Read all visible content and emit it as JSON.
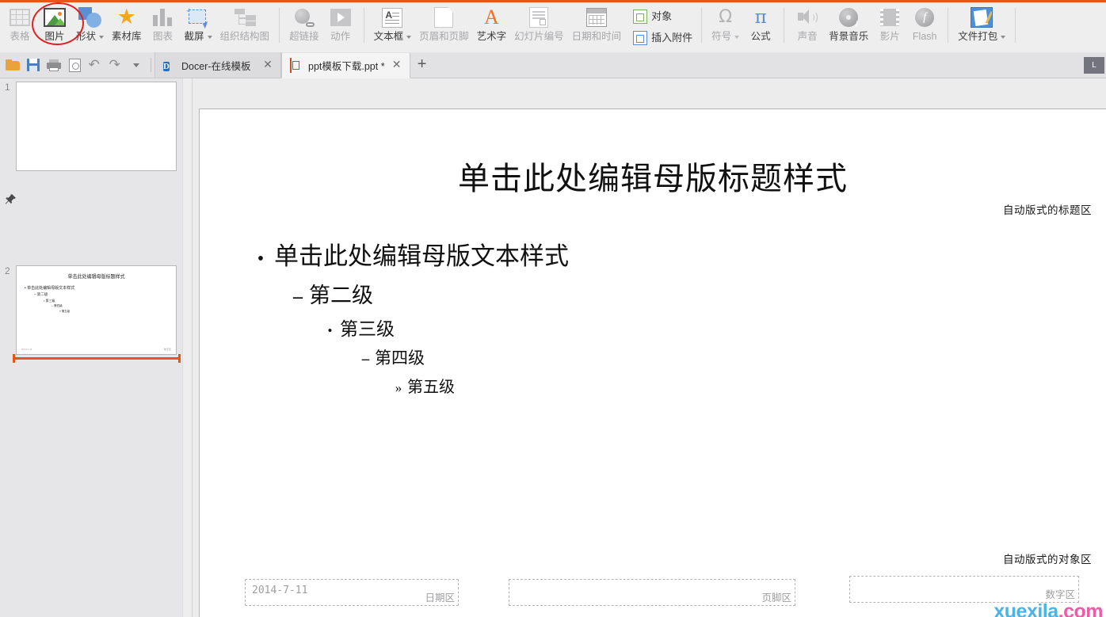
{
  "window": {
    "accent_color": "#e8541c"
  },
  "ribbon": {
    "groups": [
      {
        "name": "insert-illustrations",
        "items": [
          {
            "label": "表格",
            "icon": "table-icon",
            "dim": true,
            "caret": true
          },
          {
            "label": "图片",
            "icon": "picture-icon",
            "dim": false,
            "caret": false,
            "annotated": true
          },
          {
            "label": "形状",
            "icon": "shapes-icon",
            "dim": false,
            "caret": true
          },
          {
            "label": "素材库",
            "icon": "material-library-icon",
            "dim": false,
            "caret": false
          },
          {
            "label": "图表",
            "icon": "chart-icon",
            "dim": true,
            "caret": false
          },
          {
            "label": "截屏",
            "icon": "screenshot-icon",
            "dim": false,
            "caret": true
          },
          {
            "label": "组织结构图",
            "icon": "org-chart-icon",
            "dim": true,
            "caret": false
          }
        ]
      },
      {
        "name": "insert-links",
        "items": [
          {
            "label": "超链接",
            "icon": "hyperlink-icon",
            "dim": true,
            "caret": false
          },
          {
            "label": "动作",
            "icon": "action-icon",
            "dim": true,
            "caret": false
          }
        ]
      },
      {
        "name": "insert-text",
        "items": [
          {
            "label": "文本框",
            "icon": "textbox-icon",
            "dim": false,
            "caret": true
          },
          {
            "label": "页眉和页脚",
            "icon": "header-footer-icon",
            "dim": true,
            "caret": false
          },
          {
            "label": "艺术字",
            "icon": "wordart-icon",
            "dim": false,
            "caret": false
          },
          {
            "label": "幻灯片编号",
            "icon": "slide-number-icon",
            "dim": true,
            "caret": false
          },
          {
            "label": "日期和时间",
            "icon": "date-time-icon",
            "dim": true,
            "caret": false
          }
        ]
      },
      {
        "name": "insert-object",
        "stacked": [
          {
            "label": "对象",
            "icon": "object-icon",
            "dim": false
          },
          {
            "label": "插入附件",
            "icon": "attachment-icon",
            "dim": false
          }
        ]
      },
      {
        "name": "insert-symbols",
        "items": [
          {
            "label": "符号",
            "icon": "symbol-icon",
            "dim": true,
            "caret": true
          },
          {
            "label": "公式",
            "icon": "equation-icon",
            "dim": false,
            "caret": false
          }
        ]
      },
      {
        "name": "insert-media",
        "items": [
          {
            "label": "声音",
            "icon": "sound-icon",
            "dim": true,
            "caret": false
          },
          {
            "label": "背景音乐",
            "icon": "background-music-icon",
            "dim": false,
            "caret": false
          },
          {
            "label": "影片",
            "icon": "movie-icon",
            "dim": true,
            "caret": false
          },
          {
            "label": "Flash",
            "icon": "flash-icon",
            "dim": true,
            "caret": false
          }
        ]
      },
      {
        "name": "insert-package",
        "items": [
          {
            "label": "文件打包",
            "icon": "file-package-icon",
            "dim": false,
            "caret": true
          }
        ]
      }
    ]
  },
  "quick_access": {
    "buttons": [
      {
        "name": "open-button",
        "icon": "folder-open-icon"
      },
      {
        "name": "save-button",
        "icon": "save-icon"
      },
      {
        "name": "print-button",
        "icon": "print-icon"
      },
      {
        "name": "print-preview-button",
        "icon": "print-preview-icon"
      },
      {
        "name": "undo-button",
        "icon": "undo-arrow-icon",
        "glyph": "↶"
      },
      {
        "name": "redo-button",
        "icon": "redo-arrow-icon",
        "glyph": "↷"
      },
      {
        "name": "customize-button",
        "icon": "chevron-down-icon"
      }
    ]
  },
  "tabs": {
    "items": [
      {
        "title": "Docer-在线模板",
        "icon": "docer-icon",
        "icon_glyph": "D",
        "active": false,
        "close_glyph": "✕"
      },
      {
        "title": "ppt模板下载.ppt *",
        "icon": "ppt-file-icon",
        "active": true,
        "close_glyph": "✕"
      }
    ],
    "add_label": "+",
    "right_button_label": "L"
  },
  "slide_panel": {
    "slides": [
      {
        "number": "1",
        "selected": false,
        "has_content": false
      },
      {
        "number": "2",
        "selected": true,
        "has_content": true,
        "thumb": {
          "title": "单击此处编辑母版标题样式",
          "lines": [
            "• 单击此处编辑母版文本样式",
            "– 第二级",
            "• 第三级",
            "– 第四级",
            "» 第五级"
          ],
          "footer_left": "2014-7-11",
          "footer_right": "数字区"
        }
      }
    ],
    "pin_icon": "pushpin-icon",
    "pin_glyph": "📌"
  },
  "slide": {
    "title": "单击此处编辑母版标题样式",
    "title_note": "自动版式的标题区",
    "object_note": "自动版式的对象区",
    "body_levels": [
      {
        "bullet": "•",
        "text": "单击此处编辑母版文本样式"
      },
      {
        "bullet": "–",
        "text": "第二级"
      },
      {
        "bullet": "•",
        "text": "第三级"
      },
      {
        "bullet": "–",
        "text": "第四级"
      },
      {
        "bullet": "»",
        "text": "第五级"
      }
    ],
    "footer_boxes": [
      {
        "name": "date-placeholder",
        "label": "日期区",
        "value": "2014-7-11"
      },
      {
        "name": "footer-placeholder",
        "label": "页脚区",
        "value": ""
      },
      {
        "name": "slide-number-placeholder",
        "label": "数字区",
        "value": ""
      }
    ]
  },
  "watermark": {
    "part1": "xuexila",
    "part2": ".com",
    "color1": "#49b3ea",
    "color2": "#ef5ba6"
  }
}
